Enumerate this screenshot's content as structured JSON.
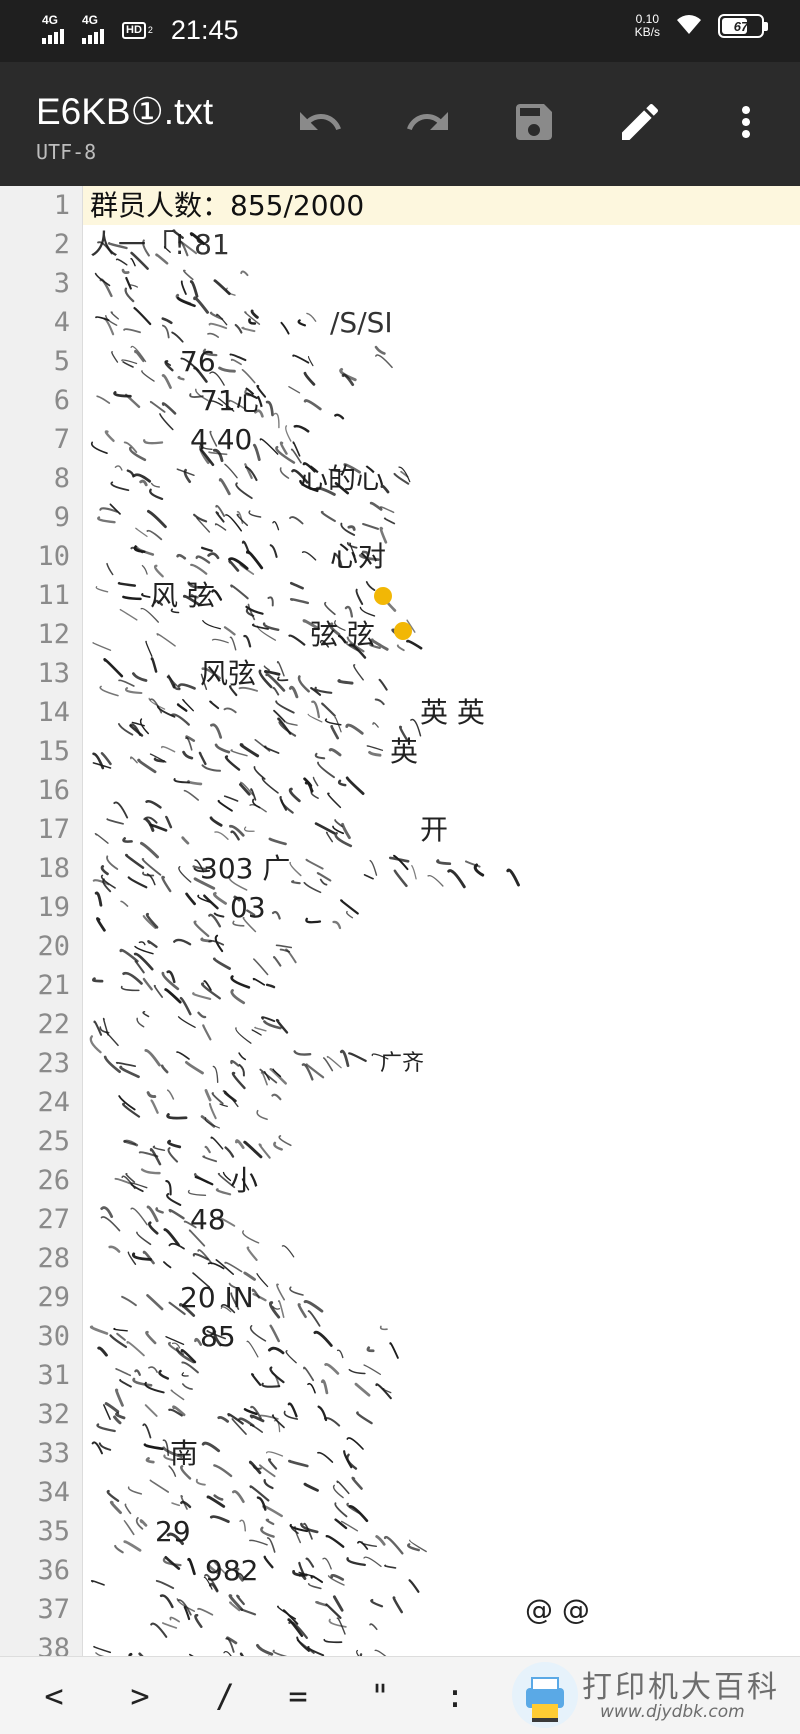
{
  "status_bar": {
    "sim1_label": "4G",
    "sim2_label": "4G",
    "hd_label": "HD",
    "hd_sub": "2",
    "time": "21:45",
    "net_speed_value": "0.10",
    "net_speed_unit": "KB/s",
    "battery_level": "67",
    "battery_fraction": 0.67
  },
  "app_bar": {
    "title": "E6KB①.txt",
    "encoding": "UTF-8",
    "icons": [
      "undo-icon",
      "redo-icon",
      "save-icon",
      "edit-icon",
      "more-vert-icon"
    ]
  },
  "editor": {
    "line_numbers": [
      "1",
      "2",
      "3",
      "4",
      "5",
      "6",
      "7",
      "8",
      "9",
      "10",
      "11",
      "12",
      "13",
      "14",
      "15",
      "16",
      "17",
      "18",
      "19",
      "20",
      "21",
      "22",
      "23",
      "24",
      "25",
      "26",
      "27",
      "28",
      "29",
      "30",
      "31",
      "32",
      "33",
      "34",
      "35",
      "36",
      "37",
      "38"
    ],
    "current_line": "1",
    "lines": {
      "l1": "群员人数：855/2000",
      "l2": "人一「! 81",
      "l4": "/S/SI",
      "l5": "76",
      "l6": "71心",
      "l7": "4 40",
      "l8": "心的心",
      "l10": "心对",
      "l11": "风 弦",
      "l12": "弦 弦",
      "l13": "风弦",
      "l14": "英 英",
      "l15": "英",
      "l17": "开",
      "l18": "303 广",
      "l19": "03",
      "l23": "广齐",
      "l26": "小",
      "l27": "48",
      "l29": "20 IN",
      "l30": "85",
      "l33": "南",
      "l35": "29",
      "l36": "982",
      "l37": "@  @"
    }
  },
  "symbol_bar": {
    "symbols": [
      "<",
      ">",
      "/",
      "=",
      "\"",
      ":"
    ]
  },
  "watermark": {
    "text": "打印机大百科",
    "url": "www.djydbk.com"
  },
  "colors": {
    "status_bar_bg": "#1f1f1f",
    "app_bar_bg": "#2b2b2b",
    "current_line_bg": "#fdf7de",
    "gutter_bg": "#f0f0f0"
  }
}
